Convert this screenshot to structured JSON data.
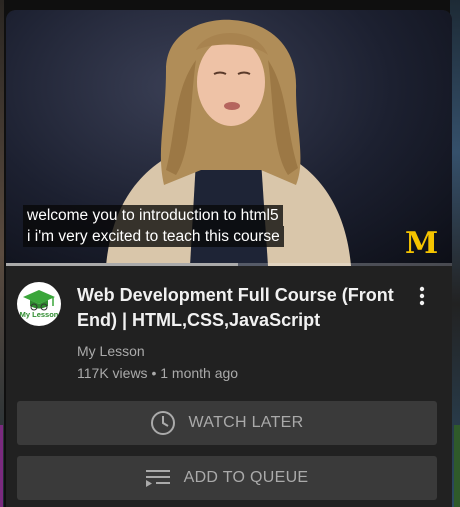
{
  "video": {
    "caption_lines": [
      "welcome you to introduction to html5",
      "i i'm very excited to teach this course"
    ],
    "brand_logo_text": "M",
    "progress_fraction": 0.52
  },
  "details": {
    "title": "Web Development Full Course (Front End) | HTML,CSS,JavaScript",
    "channel": "My Lesson",
    "channel_avatar_text": "My Lesson",
    "views": "117K views",
    "separator": "•",
    "age": "1 month ago"
  },
  "actions": {
    "watch_later": "WATCH LATER",
    "add_to_queue": "ADD TO QUEUE"
  },
  "icons": {
    "more": "more-vert-icon",
    "watch_later": "clock-icon",
    "queue": "queue-icon",
    "avatar": "graduation-cap-icon"
  },
  "colors": {
    "card": "#212121",
    "button": "#3a3a3a",
    "muted_text": "#aaaaaa",
    "brand": "#f5c400"
  }
}
